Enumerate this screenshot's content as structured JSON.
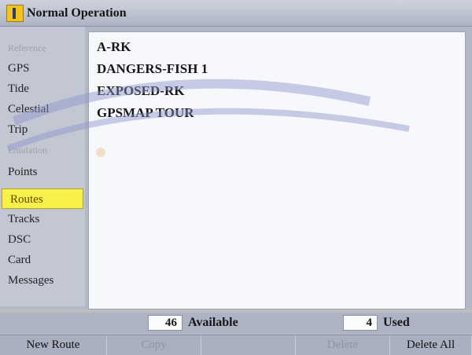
{
  "window": {
    "title": "Normal Operation"
  },
  "sidebar": {
    "items": [
      {
        "label": "Reference",
        "state": "disabled"
      },
      {
        "label": "GPS",
        "state": "normal"
      },
      {
        "label": "Tide",
        "state": "normal"
      },
      {
        "label": "Celestial",
        "state": "normal"
      },
      {
        "label": "Trip",
        "state": "normal"
      },
      {
        "label": "Emulation",
        "state": "disabled"
      },
      {
        "label": "Points",
        "state": "normal"
      },
      {
        "label": "Routes",
        "state": "selected"
      },
      {
        "label": "Tracks",
        "state": "normal"
      },
      {
        "label": "DSC",
        "state": "normal"
      },
      {
        "label": "Card",
        "state": "normal"
      },
      {
        "label": "Messages",
        "state": "normal"
      }
    ]
  },
  "routes": {
    "items": [
      "A-RK",
      "DANGERS-FISH 1",
      "EXPOSED-RK",
      "GPSMAP TOUR"
    ]
  },
  "status": {
    "available_count": "46",
    "available_label": "Available",
    "used_count": "4",
    "used_label": "Used"
  },
  "softkeys": {
    "new_route": "New Route",
    "copy": "Copy",
    "blank": "",
    "delete": "Delete",
    "delete_all": "Delete All"
  },
  "colors": {
    "selected_tab": "#f8f14a",
    "panel_background": "#f7f8fb",
    "frame": "#b3b8c6"
  }
}
